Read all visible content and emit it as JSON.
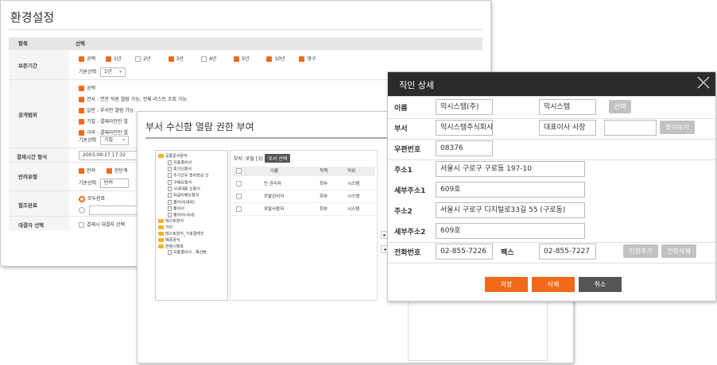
{
  "settings": {
    "title": "환경설정",
    "header": {
      "col1": "항목",
      "col2": "선택"
    },
    "retention": {
      "label": "보존기간",
      "options": [
        {
          "label": "공백",
          "checked": true
        },
        {
          "label": "1년",
          "checked": true
        },
        {
          "label": "2년",
          "checked": false
        },
        {
          "label": "3년",
          "checked": true
        },
        {
          "label": "4년",
          "checked": false
        },
        {
          "label": "5년",
          "checked": true
        },
        {
          "label": "10년",
          "checked": true
        },
        {
          "label": "영구",
          "checked": true
        }
      ],
      "default_label": "기본선택",
      "default_value": "1년"
    },
    "scope": {
      "label": "공개범위",
      "options": [
        "공백",
        "전사 : 연관 직원 열람 가능, 전체 리스트 조회 가능.",
        "일반 : 부서만 열람 가능.",
        "기밀 : 결재라인만 열",
        "극비 : 결재라인만 열"
      ],
      "default_label": "기본선택",
      "default_value": "기밀"
    },
    "time": {
      "label": "결재시간 형식",
      "value": "2003-09-27 17:32"
    },
    "reject": {
      "label": "반려유형",
      "opt1": "반려",
      "opt2": "한단계",
      "default_label": "기본선택",
      "default_value": "반려"
    },
    "consult": {
      "label": "협조완료",
      "opt1": "모두완료"
    },
    "approver": {
      "label": "대결자 선택",
      "opt1": "결재시 대결자 선택"
    }
  },
  "perm": {
    "title": "부서 수신함 열람 권한 부여",
    "tree": [
      {
        "label": "공통문서양식",
        "type": "folder",
        "level": 0
      },
      {
        "label": "지출결의서",
        "type": "doc",
        "level": 1
      },
      {
        "label": "휴가신청서",
        "type": "doc",
        "level": 1
      },
      {
        "label": "추가근무 연차보상 신",
        "type": "doc",
        "level": 1
      },
      {
        "label": "구매요청서",
        "type": "doc",
        "level": 1
      },
      {
        "label": "사내대출 신청서",
        "type": "doc",
        "level": 1
      },
      {
        "label": "자금이체요청서",
        "type": "doc",
        "level": 1
      },
      {
        "label": "품의서(대외)",
        "type": "doc",
        "level": 1
      },
      {
        "label": "품의서",
        "type": "doc",
        "level": 1
      },
      {
        "label": "품의서(사내)",
        "type": "doc",
        "level": 1
      },
      {
        "label": "테스트양식",
        "type": "folder",
        "level": 0
      },
      {
        "label": "기타",
        "type": "folder",
        "level": 0
      },
      {
        "label": "테스트양식_가로결재선",
        "type": "folder",
        "level": 0
      },
      {
        "label": "예중양식",
        "type": "folder",
        "level": 0
      },
      {
        "label": "한컴시행포",
        "type": "folder",
        "level": 0
      },
      {
        "label": "지출결의서 - 확산본",
        "type": "doc",
        "level": 1
      }
    ],
    "dept_label": "부서 :포탈 [3]",
    "dept_btn": "부서 선택",
    "columns": [
      "이름",
      "직책",
      "직위"
    ],
    "rows": [
      [
        "민 관리자",
        "회부",
        "시스템"
      ],
      [
        "포탈관리자",
        "회부",
        "시스템"
      ],
      [
        "포탈사용자",
        "회부",
        "시스템"
      ]
    ]
  },
  "detail": {
    "title": "직인 상세",
    "name_label": "이름",
    "name_value": "믹시스템(주)",
    "name_value2": "믹시스템",
    "select_btn": "선택",
    "dept_label": "부서",
    "dept_value": "믹시스템주식회사",
    "dept_value2": "대표이사 사장",
    "search_btn": "찾아보기",
    "zip_label": "우편번호",
    "zip_value": "08376",
    "addr1_label": "주소1",
    "addr1_value": "서울시 구로구 구로동 197-10",
    "addr1d_label": "세부주소1",
    "addr1d_value": "609호",
    "addr2_label": "주소2",
    "addr2_value": "서울시 구로구 디지털로33길 55 (구로동)",
    "addr2d_label": "세부주소2",
    "addr2d_value": "609호",
    "tel_label": "전화번호",
    "tel_value": "02-855-7226",
    "fax_label": "팩스",
    "fax_value": "02-855-7227",
    "seal_add_btn": "인장추가",
    "seal_del_btn": "인장삭제",
    "save_btn": "저장",
    "delete_btn": "삭제",
    "cancel_btn": "취소",
    "colors": {
      "header": "#2b2b2b",
      "accent": "#f06a1a",
      "cancel": "#555555"
    }
  }
}
